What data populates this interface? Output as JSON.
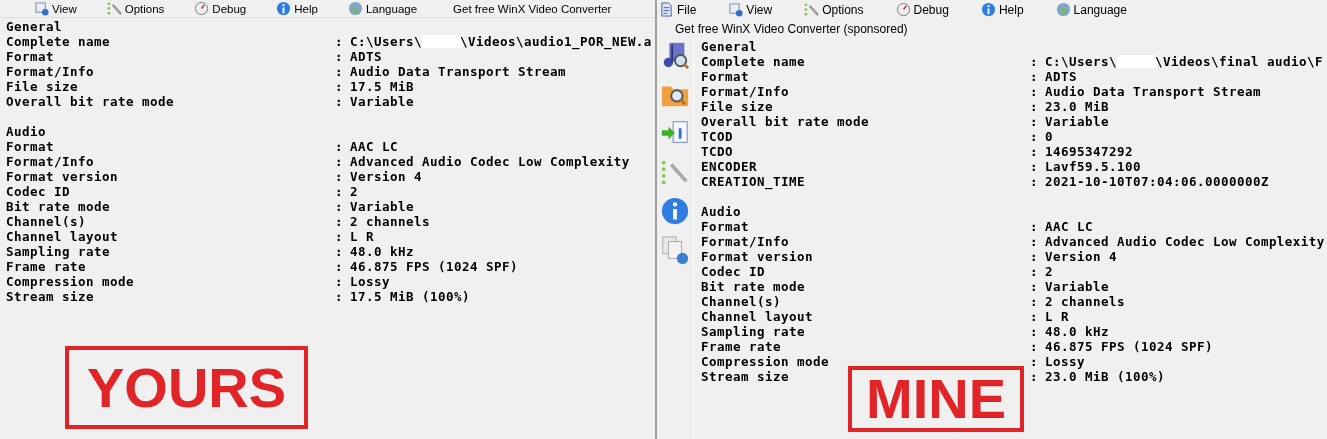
{
  "separator": ":",
  "windows": [
    {
      "menu": [
        {
          "label": "View",
          "kind": "view"
        },
        {
          "label": "Options",
          "kind": "options"
        },
        {
          "label": "Debug",
          "kind": "debug"
        },
        {
          "label": "Help",
          "kind": "help"
        },
        {
          "label": "Language",
          "kind": "language"
        },
        {
          "label": "Get free WinX Video Converter",
          "kind": "sponsor"
        }
      ],
      "side_toolbar": false,
      "sections": [
        {
          "title": "General",
          "rows": [
            {
              "label": "Complete name",
              "value": "C:\\Users\\",
              "redacted": true,
              "value_rest": "\\Videos\\audio1_POR_NEW.a"
            },
            {
              "label": "Format",
              "value": "ADTS"
            },
            {
              "label": "Format/Info",
              "value": "Audio Data Transport Stream"
            },
            {
              "label": "File size",
              "value": "17.5 MiB"
            },
            {
              "label": "Overall bit rate mode",
              "value": "Variable"
            }
          ]
        },
        {
          "title": "Audio",
          "rows": [
            {
              "label": "Format",
              "value": "AAC LC"
            },
            {
              "label": "Format/Info",
              "value": "Advanced Audio Codec Low Complexity"
            },
            {
              "label": "Format version",
              "value": "Version 4"
            },
            {
              "label": "Codec ID",
              "value": "2"
            },
            {
              "label": "Bit rate mode",
              "value": "Variable"
            },
            {
              "label": "Channel(s)",
              "value": "2 channels"
            },
            {
              "label": "Channel layout",
              "value": "L R"
            },
            {
              "label": "Sampling rate",
              "value": "48.0 kHz"
            },
            {
              "label": "Frame rate",
              "value": "46.875 FPS (1024 SPF)"
            },
            {
              "label": "Compression mode",
              "value": "Lossy"
            },
            {
              "label": "Stream size",
              "value": "17.5 MiB (100%)"
            }
          ]
        }
      ],
      "annotation": "YOURS"
    },
    {
      "menu": [
        {
          "label": "File",
          "kind": "file"
        },
        {
          "label": "View",
          "kind": "view"
        },
        {
          "label": "Options",
          "kind": "options"
        },
        {
          "label": "Debug",
          "kind": "debug"
        },
        {
          "label": "Help",
          "kind": "help"
        },
        {
          "label": "Language",
          "kind": "language"
        }
      ],
      "sponsor_line": "Get free WinX Video Converter (sponsored)",
      "side_toolbar": true,
      "sections": [
        {
          "title": "General",
          "rows": [
            {
              "label": "Complete name",
              "value": "C:\\Users\\",
              "redacted": true,
              "value_rest": "\\Videos\\final audio\\F"
            },
            {
              "label": "Format",
              "value": "ADTS"
            },
            {
              "label": "Format/Info",
              "value": "Audio Data Transport Stream"
            },
            {
              "label": "File size",
              "value": "23.0 MiB"
            },
            {
              "label": "Overall bit rate mode",
              "value": "Variable"
            },
            {
              "label": "TCOD",
              "value": "0"
            },
            {
              "label": "TCDO",
              "value": "14695347292"
            },
            {
              "label": "ENCODER",
              "value": "Lavf59.5.100"
            },
            {
              "label": "CREATION_TIME",
              "value": "2021-10-10T07:04:06.0000000Z"
            }
          ]
        },
        {
          "title": "Audio",
          "rows": [
            {
              "label": "Format",
              "value": "AAC LC"
            },
            {
              "label": "Format/Info",
              "value": "Advanced Audio Codec Low Complexity"
            },
            {
              "label": "Format version",
              "value": "Version 4"
            },
            {
              "label": "Codec ID",
              "value": "2"
            },
            {
              "label": "Bit rate mode",
              "value": "Variable"
            },
            {
              "label": "Channel(s)",
              "value": "2 channels"
            },
            {
              "label": "Channel layout",
              "value": "L R"
            },
            {
              "label": "Sampling rate",
              "value": "48.0 kHz"
            },
            {
              "label": "Frame rate",
              "value": "46.875 FPS (1024 SPF)"
            },
            {
              "label": "Compression mode",
              "value": "Lossy"
            },
            {
              "label": "Stream size",
              "value": "23.0 MiB (100%)"
            }
          ]
        }
      ],
      "annotation": "MINE"
    }
  ]
}
